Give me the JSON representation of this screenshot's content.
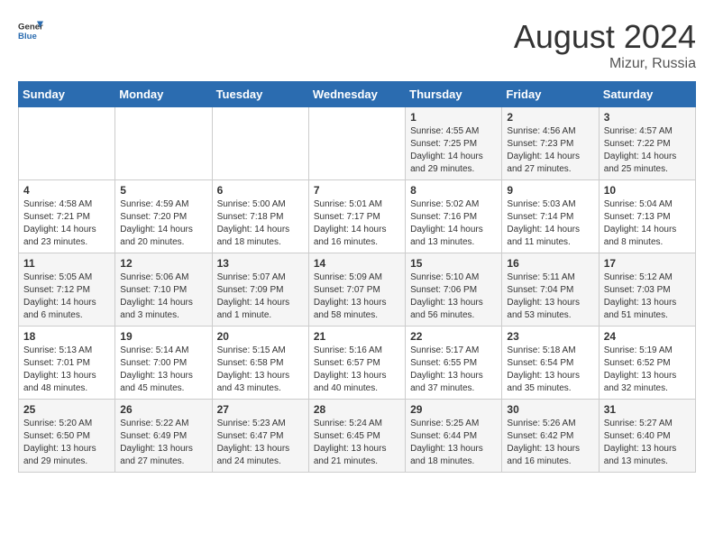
{
  "header": {
    "logo_general": "General",
    "logo_blue": "Blue",
    "month_year": "August 2024",
    "location": "Mizur, Russia"
  },
  "weekdays": [
    "Sunday",
    "Monday",
    "Tuesday",
    "Wednesday",
    "Thursday",
    "Friday",
    "Saturday"
  ],
  "weeks": [
    [
      {
        "day": "",
        "info": ""
      },
      {
        "day": "",
        "info": ""
      },
      {
        "day": "",
        "info": ""
      },
      {
        "day": "",
        "info": ""
      },
      {
        "day": "1",
        "info": "Sunrise: 4:55 AM\nSunset: 7:25 PM\nDaylight: 14 hours\nand 29 minutes."
      },
      {
        "day": "2",
        "info": "Sunrise: 4:56 AM\nSunset: 7:23 PM\nDaylight: 14 hours\nand 27 minutes."
      },
      {
        "day": "3",
        "info": "Sunrise: 4:57 AM\nSunset: 7:22 PM\nDaylight: 14 hours\nand 25 minutes."
      }
    ],
    [
      {
        "day": "4",
        "info": "Sunrise: 4:58 AM\nSunset: 7:21 PM\nDaylight: 14 hours\nand 23 minutes."
      },
      {
        "day": "5",
        "info": "Sunrise: 4:59 AM\nSunset: 7:20 PM\nDaylight: 14 hours\nand 20 minutes."
      },
      {
        "day": "6",
        "info": "Sunrise: 5:00 AM\nSunset: 7:18 PM\nDaylight: 14 hours\nand 18 minutes."
      },
      {
        "day": "7",
        "info": "Sunrise: 5:01 AM\nSunset: 7:17 PM\nDaylight: 14 hours\nand 16 minutes."
      },
      {
        "day": "8",
        "info": "Sunrise: 5:02 AM\nSunset: 7:16 PM\nDaylight: 14 hours\nand 13 minutes."
      },
      {
        "day": "9",
        "info": "Sunrise: 5:03 AM\nSunset: 7:14 PM\nDaylight: 14 hours\nand 11 minutes."
      },
      {
        "day": "10",
        "info": "Sunrise: 5:04 AM\nSunset: 7:13 PM\nDaylight: 14 hours\nand 8 minutes."
      }
    ],
    [
      {
        "day": "11",
        "info": "Sunrise: 5:05 AM\nSunset: 7:12 PM\nDaylight: 14 hours\nand 6 minutes."
      },
      {
        "day": "12",
        "info": "Sunrise: 5:06 AM\nSunset: 7:10 PM\nDaylight: 14 hours\nand 3 minutes."
      },
      {
        "day": "13",
        "info": "Sunrise: 5:07 AM\nSunset: 7:09 PM\nDaylight: 14 hours\nand 1 minute."
      },
      {
        "day": "14",
        "info": "Sunrise: 5:09 AM\nSunset: 7:07 PM\nDaylight: 13 hours\nand 58 minutes."
      },
      {
        "day": "15",
        "info": "Sunrise: 5:10 AM\nSunset: 7:06 PM\nDaylight: 13 hours\nand 56 minutes."
      },
      {
        "day": "16",
        "info": "Sunrise: 5:11 AM\nSunset: 7:04 PM\nDaylight: 13 hours\nand 53 minutes."
      },
      {
        "day": "17",
        "info": "Sunrise: 5:12 AM\nSunset: 7:03 PM\nDaylight: 13 hours\nand 51 minutes."
      }
    ],
    [
      {
        "day": "18",
        "info": "Sunrise: 5:13 AM\nSunset: 7:01 PM\nDaylight: 13 hours\nand 48 minutes."
      },
      {
        "day": "19",
        "info": "Sunrise: 5:14 AM\nSunset: 7:00 PM\nDaylight: 13 hours\nand 45 minutes."
      },
      {
        "day": "20",
        "info": "Sunrise: 5:15 AM\nSunset: 6:58 PM\nDaylight: 13 hours\nand 43 minutes."
      },
      {
        "day": "21",
        "info": "Sunrise: 5:16 AM\nSunset: 6:57 PM\nDaylight: 13 hours\nand 40 minutes."
      },
      {
        "day": "22",
        "info": "Sunrise: 5:17 AM\nSunset: 6:55 PM\nDaylight: 13 hours\nand 37 minutes."
      },
      {
        "day": "23",
        "info": "Sunrise: 5:18 AM\nSunset: 6:54 PM\nDaylight: 13 hours\nand 35 minutes."
      },
      {
        "day": "24",
        "info": "Sunrise: 5:19 AM\nSunset: 6:52 PM\nDaylight: 13 hours\nand 32 minutes."
      }
    ],
    [
      {
        "day": "25",
        "info": "Sunrise: 5:20 AM\nSunset: 6:50 PM\nDaylight: 13 hours\nand 29 minutes."
      },
      {
        "day": "26",
        "info": "Sunrise: 5:22 AM\nSunset: 6:49 PM\nDaylight: 13 hours\nand 27 minutes."
      },
      {
        "day": "27",
        "info": "Sunrise: 5:23 AM\nSunset: 6:47 PM\nDaylight: 13 hours\nand 24 minutes."
      },
      {
        "day": "28",
        "info": "Sunrise: 5:24 AM\nSunset: 6:45 PM\nDaylight: 13 hours\nand 21 minutes."
      },
      {
        "day": "29",
        "info": "Sunrise: 5:25 AM\nSunset: 6:44 PM\nDaylight: 13 hours\nand 18 minutes."
      },
      {
        "day": "30",
        "info": "Sunrise: 5:26 AM\nSunset: 6:42 PM\nDaylight: 13 hours\nand 16 minutes."
      },
      {
        "day": "31",
        "info": "Sunrise: 5:27 AM\nSunset: 6:40 PM\nDaylight: 13 hours\nand 13 minutes."
      }
    ]
  ]
}
